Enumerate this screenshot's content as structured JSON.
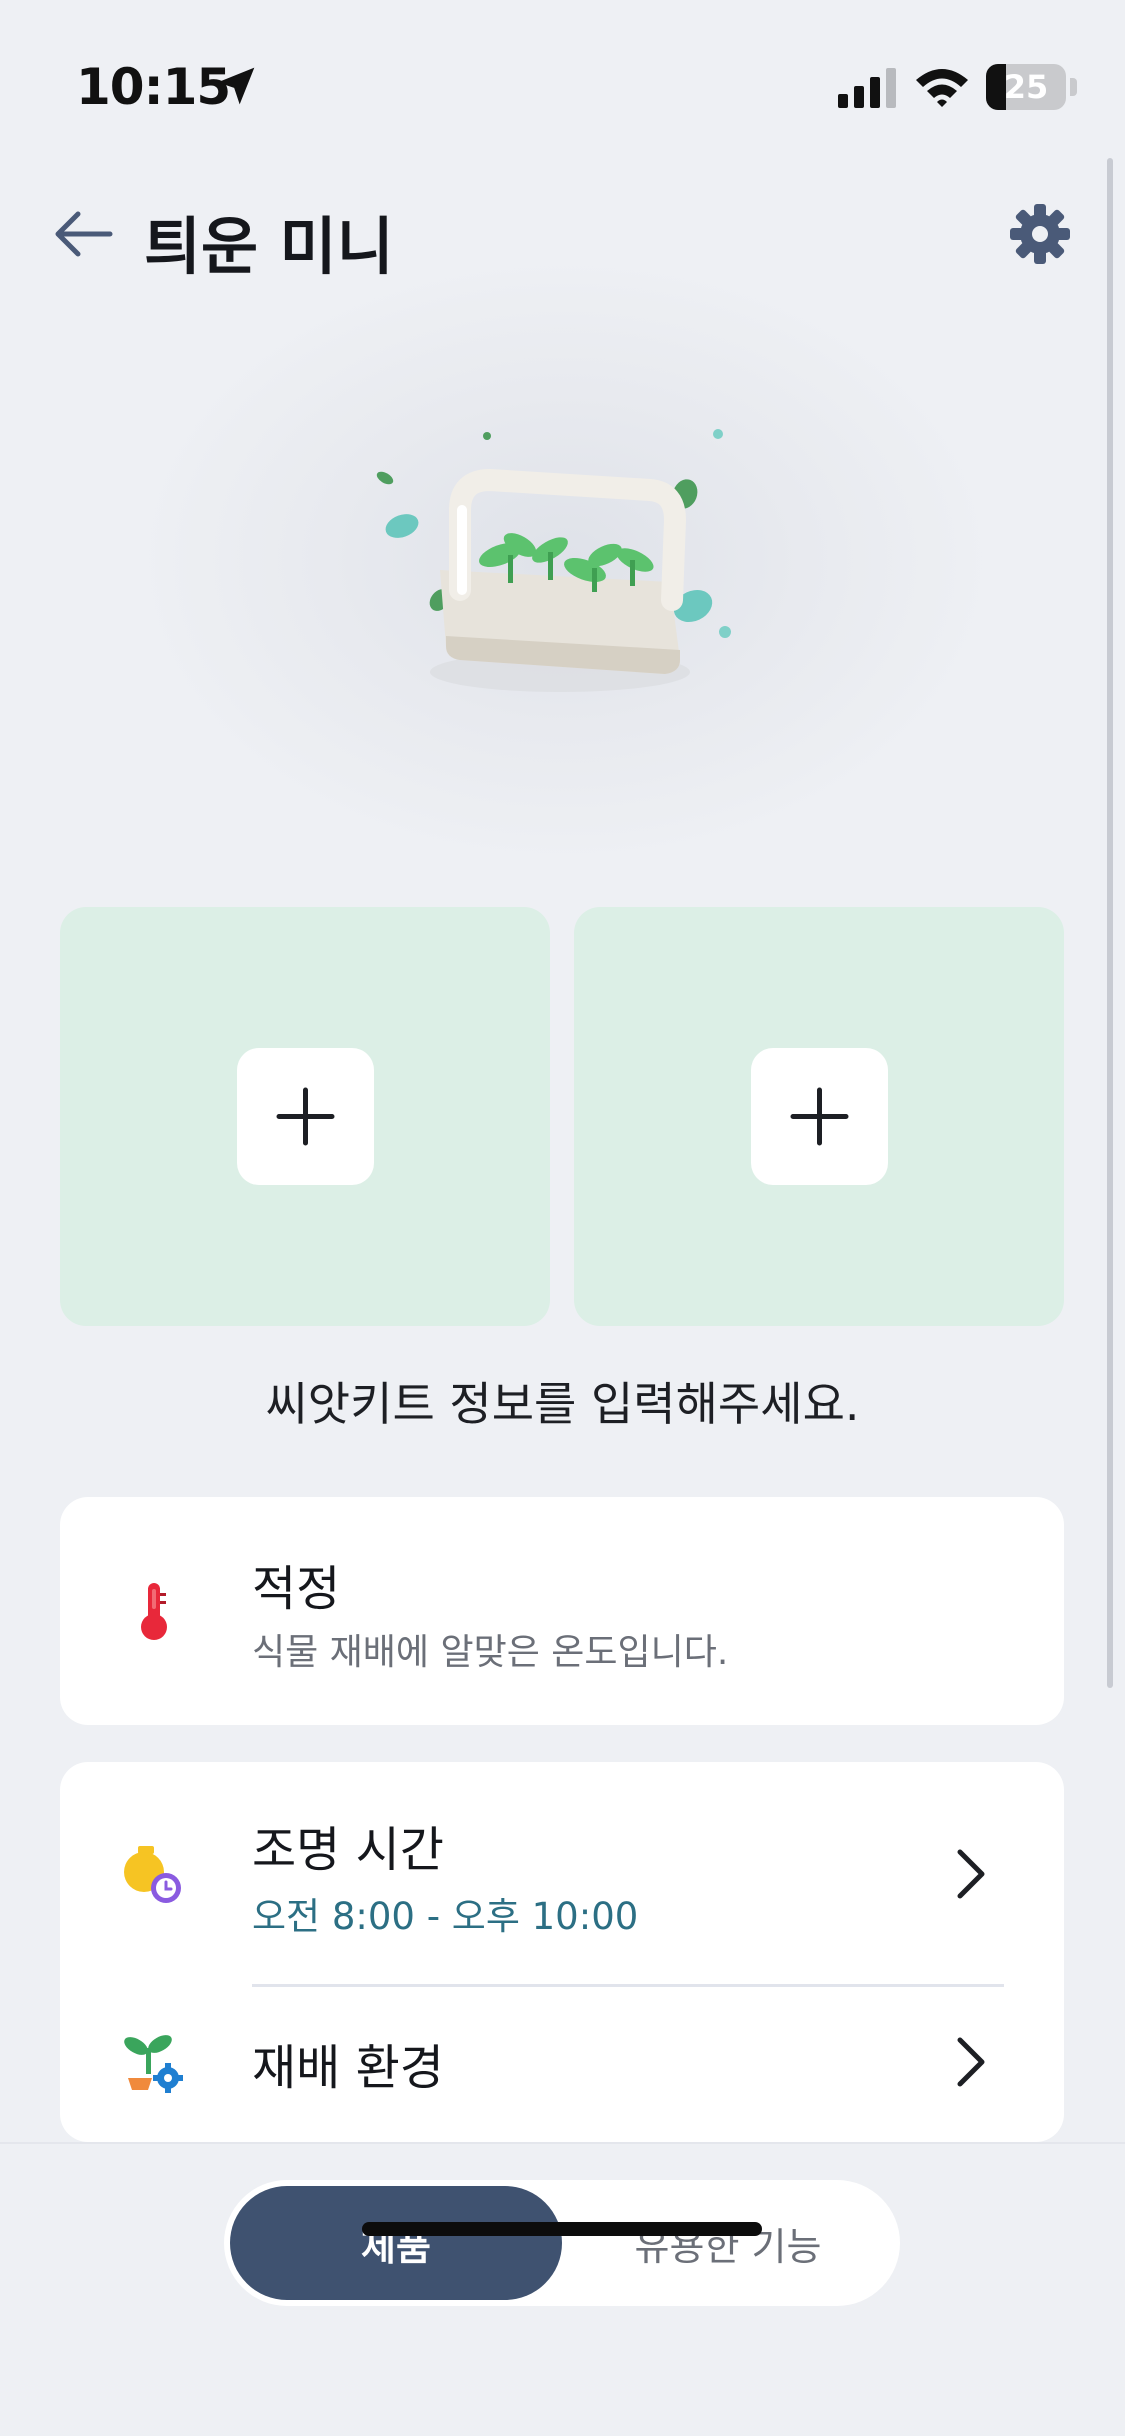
{
  "status_bar": {
    "time": "10:15",
    "battery": "25",
    "battery_level": 0.25
  },
  "header": {
    "title": "틔운 미니"
  },
  "seed_slots": {
    "prompt": "씨앗키트 정보를 입력해주세요."
  },
  "temperature_card": {
    "title": "적정",
    "subtitle": "식물 재배에 알맞은 온도입니다."
  },
  "lighting_row": {
    "title": "조명 시간",
    "time": "오전 8:00 - 오후 10:00"
  },
  "environment_row": {
    "title": "재배 환경"
  },
  "bottom_tabs": {
    "product": "제품",
    "features": "유용한 기능"
  },
  "icons": {
    "back": "arrow-left-icon",
    "settings": "gear-icon",
    "add": "plus-icon",
    "temperature": "thermometer-icon",
    "lighting": "bulb-clock-icon",
    "environment": "plant-gear-icon",
    "chevron": "chevron-right-icon"
  },
  "colors": {
    "accent": "#3f5270",
    "slot_background": "#dcefe6",
    "time_text": "#2c6f84",
    "thermometer": "#e8283a"
  }
}
